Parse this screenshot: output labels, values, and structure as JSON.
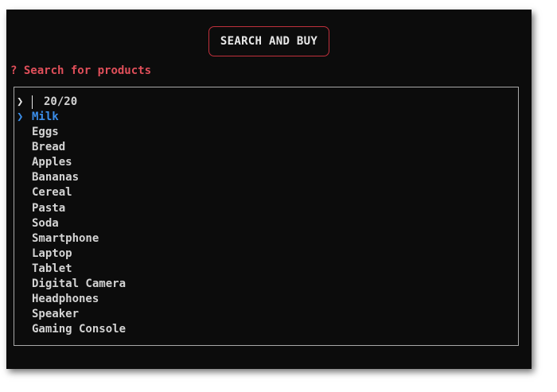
{
  "header": {
    "title": "SEARCH AND BUY"
  },
  "prompt": {
    "marker": "?",
    "text": "Search for products"
  },
  "query": {
    "prompt_glyph": "❯",
    "value": "",
    "count": "20/20"
  },
  "list": {
    "pointer_glyph": "❯",
    "selected_index": 0,
    "items": [
      "Milk",
      "Eggs",
      "Bread",
      "Apples",
      "Bananas",
      "Cereal",
      "Pasta",
      "Soda",
      "Smartphone",
      "Laptop",
      "Tablet",
      "Digital Camera",
      "Headphones",
      "Speaker",
      "Gaming Console"
    ]
  },
  "colors": {
    "background": "#0c0c0c",
    "accent_red": "#e04f5a",
    "border_red": "#c0303c",
    "selection_blue": "#3b8eea",
    "text": "#d4d4d4"
  }
}
